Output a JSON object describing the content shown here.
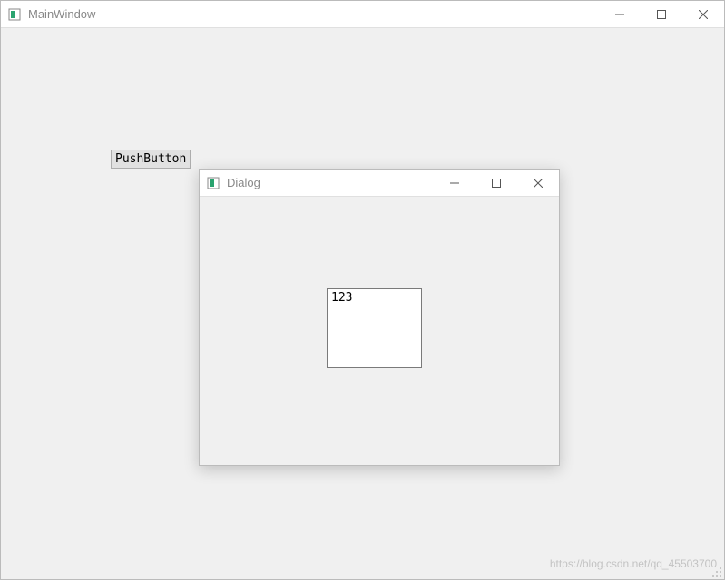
{
  "main_window": {
    "title": "MainWindow",
    "push_button_label": "PushButton"
  },
  "dialog": {
    "title": "Dialog",
    "text_value": "123"
  },
  "watermark": "https://blog.csdn.net/qq_45503700",
  "icons": {
    "app": "app-icon",
    "minimize": "minimize-icon",
    "maximize": "maximize-icon",
    "close": "close-icon"
  }
}
